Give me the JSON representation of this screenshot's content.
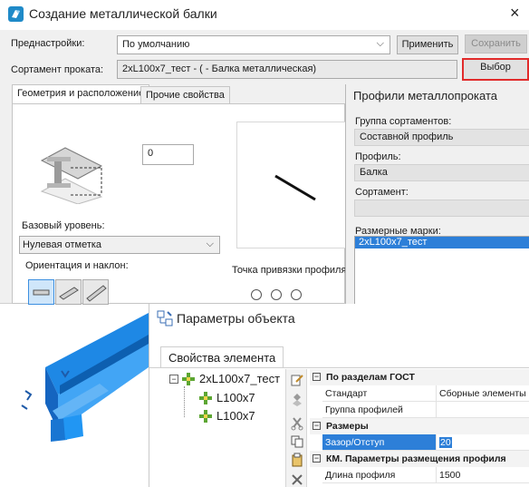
{
  "dialog": {
    "title": "Создание металлической балки",
    "presets_label": "Преднастройки:",
    "presets_value": "По умолчанию",
    "apply_label": "Применить",
    "save_label": "Сохранить",
    "assortment_label": "Сортамент проката:",
    "assortment_value": "2xL100x7_тест - ( - Балка металлическая)",
    "select_label": "Выбор",
    "tabs": [
      "Геометрия и расположение",
      "Прочие свойства"
    ],
    "offset_value": "0",
    "base_level_label": "Базовый уровень:",
    "base_level_value": "Нулевая отметка",
    "orientation_label": "Ориентация и наклон:",
    "anchor_label": "Точка привязки профиля:"
  },
  "profiles": {
    "title": "Профили металлопроката",
    "group_label": "Группа сортаментов:",
    "group_value": "Составной профиль",
    "profile_label": "Профиль:",
    "profile_value": "Балка",
    "assortment_label": "Сортамент:",
    "marks_label": "Размерные марки:",
    "marks": [
      "2xL100x7_тест"
    ]
  },
  "params": {
    "title": "Параметры объекта",
    "tab": "Свойства элемента",
    "tree": {
      "root": "2xL100x7_тест",
      "children": [
        "L100x7",
        "L100x7"
      ]
    },
    "grid": {
      "cat_gost": "По разделам ГОСТ",
      "standard_name": "Стандарт",
      "standard_value": "Сборные элементы",
      "group_name": "Группа профилей",
      "group_value": "",
      "cat_sizes": "Размеры",
      "gap_name": "Зазор/Отступ",
      "gap_value": "20",
      "cat_km": "КМ. Параметры размещения профиля",
      "length_name": "Длина профиля",
      "length_value": "1500"
    }
  },
  "colors": {
    "accent": "#2d7fd8",
    "beam_blue": "#1e88e5",
    "focus_red": "#e12b2b",
    "tree_green": "#5ca632"
  }
}
